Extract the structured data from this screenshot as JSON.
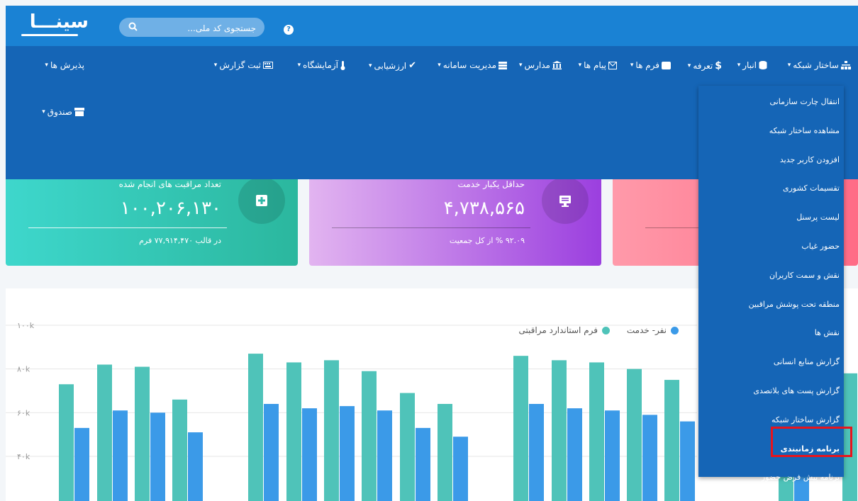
{
  "app": {
    "logo": "سینـــا",
    "search_placeholder": "جستجوی کد ملی..."
  },
  "nav": {
    "items": [
      {
        "label": "ساختار شبکه",
        "icon": "sitemap-icon"
      },
      {
        "label": "انبار",
        "icon": "database-icon"
      },
      {
        "label": "تعرفه",
        "icon": "dollar-icon"
      },
      {
        "label": "فرم ها",
        "icon": "form-icon"
      },
      {
        "label": "پیام ها",
        "icon": "envelope-icon"
      },
      {
        "label": "مدارس",
        "icon": "bank-icon"
      },
      {
        "label": "مدیریت سامانه",
        "icon": "table-icon"
      },
      {
        "label": "ارزشیابی",
        "icon": "check-icon"
      },
      {
        "label": "آزمایشگاه",
        "icon": "thermometer-icon"
      },
      {
        "label": "ثبت گزارش",
        "icon": "keyboard-icon"
      },
      {
        "label": "پذیرش ها",
        "icon": ""
      },
      {
        "label": "صندوق",
        "icon": "box-icon"
      }
    ]
  },
  "cards": [
    {
      "title": "تعداد مراقبت های انجام شده",
      "value": "۱۰۰,۲۰۶,۱۳۰",
      "sub": "در قالب ۷۷,۹۱۴,۴۷۰ فرم",
      "icon": "plus-square-icon"
    },
    {
      "title": "حداقل یکبار خدمت",
      "value": "۴,۷۳۸,۵۶۵",
      "sub": "۹۲.۰۹ % از کل جمعیت",
      "icon": "desktop-icon"
    },
    {
      "title": "",
      "value": "",
      "sub": "",
      "icon": ""
    }
  ],
  "legend": {
    "series1": "نفر- خدمت",
    "series2": "فرم استاندارد مراقبتی"
  },
  "colors": {
    "series1": "#3b9ae8",
    "series2": "#4fc3b9"
  },
  "chart_data": {
    "type": "bar",
    "yticks": [
      "۱۰۰k",
      "۸۰k",
      "۶۰k",
      "۴۰k"
    ],
    "ylim": [
      30000,
      100000
    ],
    "series": [
      {
        "name": "فرم استاندارد مراقبتی",
        "values": [
          73000,
          82000,
          81000,
          66000,
          87000,
          83000,
          84000,
          79000,
          69000,
          64000,
          86000,
          84000,
          83000,
          80000,
          75000,
          77000,
          78000
        ]
      },
      {
        "name": "نفر- خدمت",
        "values": [
          53000,
          61000,
          60000,
          51000,
          64000,
          62000,
          63000,
          61000,
          53000,
          49000,
          64000,
          62000,
          61000,
          59000,
          56000,
          56000,
          58000
        ]
      }
    ]
  },
  "dropdown": {
    "items": [
      "انتقال چارت سازمانی",
      "مشاهده ساختار شبکه",
      "افزودن کاربر جدید",
      "تقسیمات کشوری",
      "لیست پرسنل",
      "حضور غیاب",
      "نقش و سمت کاربران",
      "منطقه تحت پوشش مراقبین",
      "نقش ها",
      "گزارش منابع انسانی",
      "گزارش پست های بلاتصدی",
      "گزارش ساختار شبکه",
      "برنامه زمانبندی",
      "برنامه پیش فرض حضور"
    ],
    "highlighted_index": 12
  }
}
